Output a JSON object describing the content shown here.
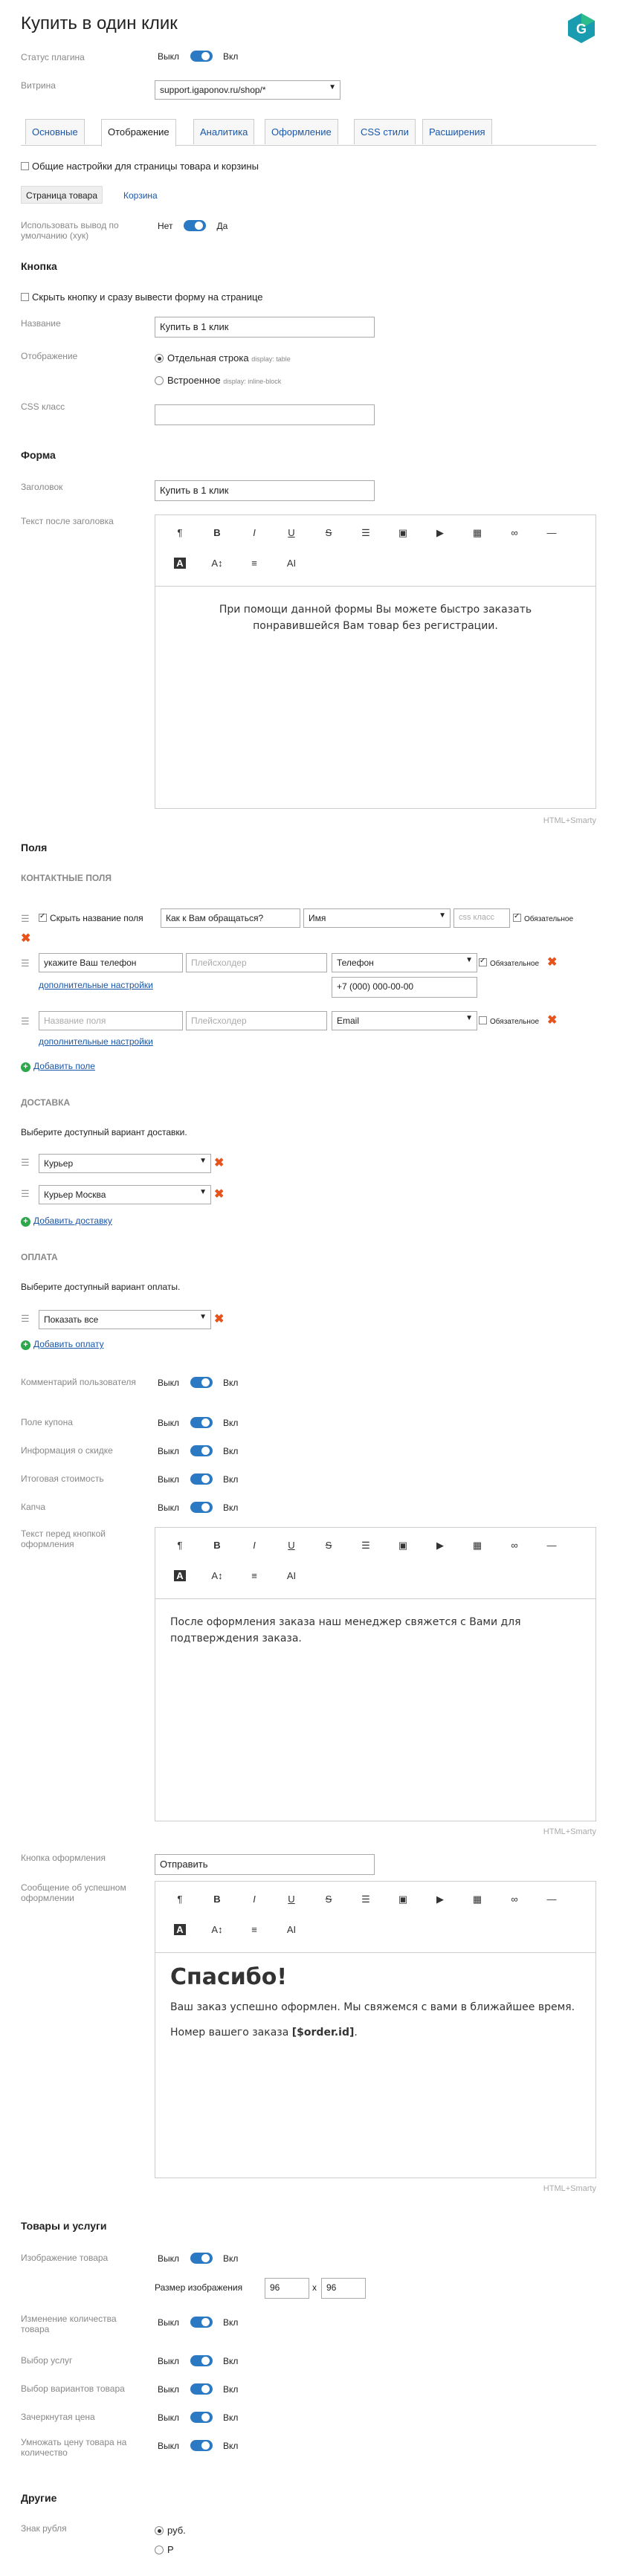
{
  "title": "Купить в один клик",
  "status": {
    "label": "Статус плагина",
    "off": "Выкл",
    "on": "Вкл"
  },
  "vitrina": {
    "label": "Витрина",
    "value": "support.igaponov.ru/shop/*"
  },
  "tabs": [
    "Основные",
    "Отображение",
    "Аналитика",
    "Оформление",
    "CSS стили",
    "Расширения"
  ],
  "common_settings": "Общие настройки для страницы товара и корзины",
  "subtabs": {
    "product": "Страница товара",
    "cart": "Корзина"
  },
  "default_output": {
    "label": "Использовать вывод по умолчанию (хук)",
    "no": "Нет",
    "yes": "Да"
  },
  "button_section": {
    "title": "Кнопка",
    "hide": "Скрыть кнопку и сразу вывести форму на странице",
    "name_label": "Название",
    "name_value": "Купить в 1 клик",
    "display_label": "Отображение",
    "opt1": "Отдельная строка",
    "opt1_hint": "display: table",
    "opt2": "Встроенное",
    "opt2_hint": "display: inline-block",
    "css_label": "CSS класс"
  },
  "form": {
    "title": "Форма",
    "heading_label": "Заголовок",
    "heading_value": "Купить в 1 клик",
    "after_label": "Текст после заголовка",
    "after_text": "При помощи данной формы Вы можете быстро заказать понравившейся Вам товар без регистрации."
  },
  "editor": {
    "hs": "HTML+Smarty",
    "b": "B",
    "i": "I",
    "u": "U",
    "s": "S",
    "p": "¶",
    "ab": "A",
    "font": "A↕"
  },
  "fields": {
    "title": "Поля",
    "contacts_title": "КОНТАКТНЫЕ ПОЛЯ",
    "row1": {
      "hide": "Скрыть название поля",
      "question": "Как к Вам обращаться?",
      "type": "Имя",
      "css": "css класс",
      "req": "Обязательное"
    },
    "row2": {
      "name": "укажите Ваш телефон",
      "placeholder": "Плейсхолдер",
      "type": "Телефон",
      "req": "Обязательное",
      "mask": "+7 (000) 000-00-00",
      "more": "дополнительные настройки"
    },
    "row3": {
      "name": "Название поля",
      "placeholder": "Плейсхолдер",
      "type": "Email",
      "req": "Обязательное",
      "more": "дополнительные настройки"
    },
    "add": "Добавить поле"
  },
  "delivery": {
    "title": "ДОСТАВКА",
    "hint": "Выберите доступный вариант доставки.",
    "items": [
      "Курьер",
      "Курьер Москва"
    ],
    "add": "Добавить доставку"
  },
  "payment": {
    "title": "ОПЛАТА",
    "hint": "Выберите доступный вариант оплаты.",
    "items": [
      "Показать все"
    ],
    "add": "Добавить оплату"
  },
  "toggles": [
    {
      "label": "Комментарий пользователя",
      "off": "Выкл",
      "on": "Вкл"
    },
    {
      "label": "Поле купона",
      "off": "Выкл",
      "on": "Вкл"
    },
    {
      "label": "Информация о скидке",
      "off": "Выкл",
      "on": "Вкл"
    },
    {
      "label": "Итоговая стоимость",
      "off": "Выкл",
      "on": "Вкл"
    },
    {
      "label": "Капча",
      "off": "Выкл",
      "on": "Вкл"
    }
  ],
  "before_btn": {
    "label": "Текст перед кнопкой оформления",
    "text": "После оформления заказа наш менеджер свяжется с Вами для подтверждения заказа."
  },
  "order_btn": {
    "label": "Кнопка оформления",
    "value": "Отправить"
  },
  "success": {
    "label": "Сообщение об успешном оформлении",
    "heading": "Спасибо!",
    "line1": "Ваш заказ успешно оформлен. Мы свяжемся с вами в ближайшее время.",
    "line2_pre": "Номер вашего заказа ",
    "line2_var": "[$order.id]",
    "line2_post": "."
  },
  "goods": {
    "title": "Товары и услуги",
    "image": {
      "label": "Изображение товара",
      "off": "Выкл",
      "on": "Вкл"
    },
    "size": {
      "label": "Размер изображения",
      "w": "96",
      "x": "x",
      "h": "96"
    },
    "rows": [
      {
        "label": "Изменение количества товара",
        "off": "Выкл",
        "on": "Вкл"
      },
      {
        "label": "Выбор услуг",
        "off": "Выкл",
        "on": "Вкл"
      },
      {
        "label": "Выбор вариантов товара",
        "off": "Выкл",
        "on": "Вкл"
      },
      {
        "label": "Зачеркнутая цена",
        "off": "Выкл",
        "on": "Вкл"
      },
      {
        "label": "Умножать цену товара на количество",
        "off": "Выкл",
        "on": "Вкл"
      }
    ]
  },
  "other": {
    "title": "Другие",
    "ruble_label": "Знак рубля",
    "opt1": "руб.",
    "opt2": "Р"
  },
  "colors": {
    "accent": "#2b79c2",
    "link": "#1a57a8",
    "add": "#2aa84a",
    "delete": "#e8531d"
  }
}
